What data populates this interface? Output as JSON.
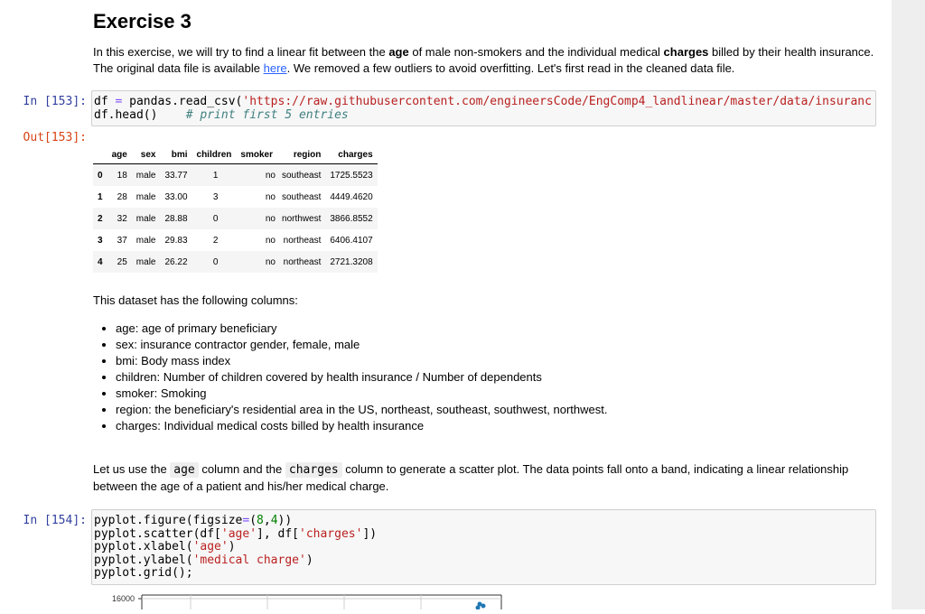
{
  "heading": "Exercise 3",
  "intro": {
    "t1": "In this exercise, we will try to find a linear fit between the ",
    "b1": "age",
    "t2": " of male non-smokers and the individual medical ",
    "b2": "charges",
    "t3": " billed by their health insurance. The original data file is available ",
    "link": "here",
    "t4": ". We removed a few outliers to avoid overfitting. Let's first read in the cleaned data file."
  },
  "cell1": {
    "prompt": "In [153]:",
    "line1_a": "df ",
    "line1_op": "=",
    "line1_b": " pandas.read_csv(",
    "line1_str": "'https://raw.githubusercontent.com/engineersCode/EngComp4_landlinear/master/data/insuranc",
    "line2_code": "df.head()    ",
    "line2_comment": "# print first 5 entries"
  },
  "out1": {
    "prompt": "Out[153]:",
    "columns": [
      "",
      "age",
      "sex",
      "bmi",
      "children",
      "smoker",
      "region",
      "charges"
    ],
    "rows": [
      [
        "0",
        "18",
        "male",
        "33.77",
        "1",
        "no",
        "southeast",
        "1725.5523"
      ],
      [
        "1",
        "28",
        "male",
        "33.00",
        "3",
        "no",
        "southeast",
        "4449.4620"
      ],
      [
        "2",
        "32",
        "male",
        "28.88",
        "0",
        "no",
        "northwest",
        "3866.8552"
      ],
      [
        "3",
        "37",
        "male",
        "29.83",
        "2",
        "no",
        "northeast",
        "6406.4107"
      ],
      [
        "4",
        "25",
        "male",
        "26.22",
        "0",
        "no",
        "northeast",
        "2721.3208"
      ]
    ]
  },
  "columns_intro": "This dataset has the following columns:",
  "column_desc": [
    "age: age of primary beneficiary",
    "sex: insurance contractor gender, female, male",
    "bmi: Body mass index",
    "children: Number of children covered by health insurance / Number of dependents",
    "smoker: Smoking",
    "region: the beneficiary's residential area in the US, northeast, southeast, southwest, northwest.",
    "charges: Individual medical costs billed by health insurance"
  ],
  "scatter_text": {
    "t1": "Let us use the ",
    "c1": "age",
    "t2": " column and the ",
    "c2": "charges",
    "t3": " column to generate a scatter plot. The data points fall onto a band, indicating a linear relationship between the age of a patient and his/her medical charge."
  },
  "cell2": {
    "prompt": "In [154]:",
    "l1_a": "pyplot.figure(figsize",
    "l1_op": "=",
    "l1_b": "(",
    "l1_n1": "8",
    "l1_c": ",",
    "l1_n2": "4",
    "l1_d": "))",
    "l2_a": "pyplot.scatter(df[",
    "l2_s1": "'age'",
    "l2_b": "], df[",
    "l2_s2": "'charges'",
    "l2_c": "])",
    "l3_a": "pyplot.xlabel(",
    "l3_s": "'age'",
    "l3_b": ")",
    "l4_a": "pyplot.ylabel(",
    "l4_s": "'medical charge'",
    "l4_b": ")",
    "l5": "pyplot.grid();"
  },
  "plot": {
    "ytick_top": "16000"
  }
}
